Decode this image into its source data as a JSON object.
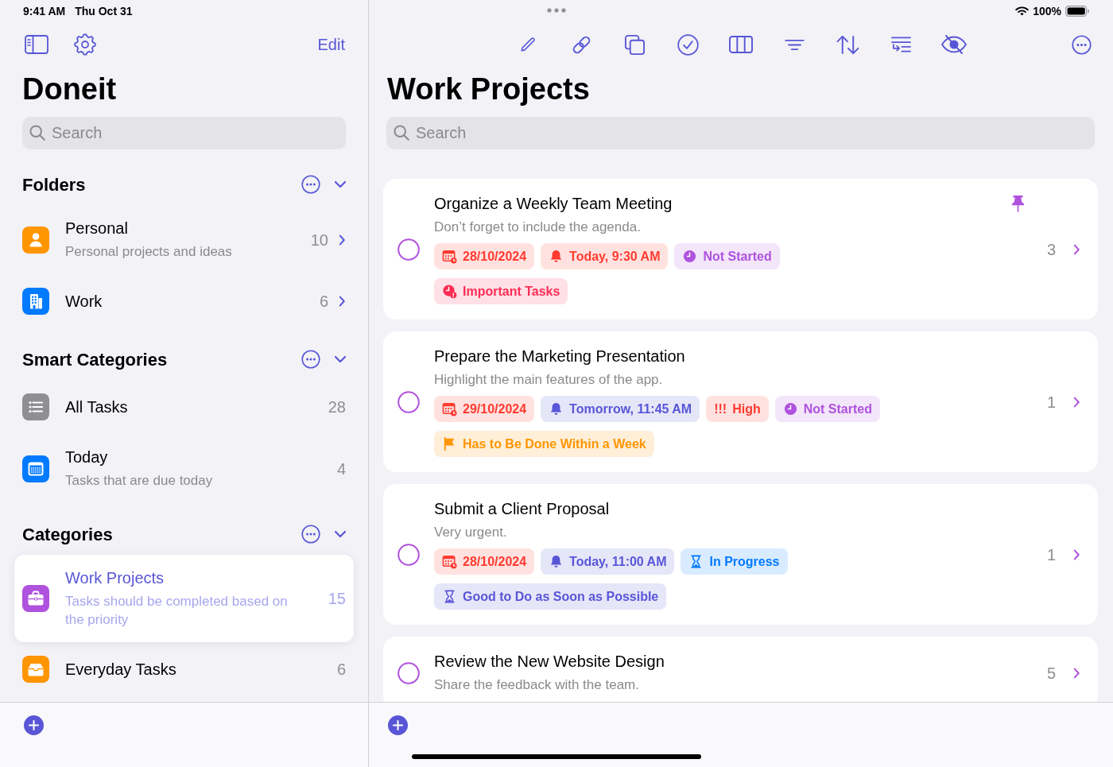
{
  "status_bar": {
    "time": "9:41 AM",
    "date": "Thu Oct 31",
    "battery": "100%"
  },
  "sidebar": {
    "edit": "Edit",
    "title": "Doneit",
    "search": {
      "placeholder": "Search"
    },
    "sections": [
      {
        "title": "Folders",
        "expanded": true,
        "items": [
          {
            "kind": "folder",
            "title": "Personal",
            "subtitle": "Personal projects and ideas",
            "count": "10",
            "color": "#ff9500",
            "selected": false
          },
          {
            "kind": "folder",
            "title": "Work",
            "count": "6",
            "color": "#007aff",
            "selected": false
          }
        ]
      },
      {
        "title": "Smart Categories",
        "expanded": true,
        "items": [
          {
            "kind": "category",
            "title": "All Tasks",
            "count": "28",
            "color": "#8e8e93",
            "selected": false
          },
          {
            "kind": "category",
            "title": "Today",
            "subtitle": "Tasks that are due today",
            "count": "4",
            "color": "#007aff",
            "selected": false
          }
        ]
      },
      {
        "title": "Categories",
        "expanded": true,
        "items": [
          {
            "kind": "category",
            "title": "Work Projects",
            "subtitle": "Tasks should be completed based on the priority",
            "count": "15",
            "color": "#af52de",
            "selected": true
          },
          {
            "kind": "category",
            "title": "Everyday Tasks",
            "count": "6",
            "color": "#ff9500",
            "selected": false
          }
        ]
      }
    ]
  },
  "main": {
    "title": "Work Projects",
    "search": {
      "placeholder": "Search"
    },
    "tasks": [
      {
        "title": "Organize a Weekly Team Meeting",
        "note": "Don’t forget to include the agenda.",
        "count": "3",
        "pinned": true,
        "completed": false,
        "tags": [
          {
            "kind": "date",
            "text": "28/10/2024",
            "color": "#ff3b30"
          },
          {
            "kind": "reminder",
            "text": "Today, 9:30 AM",
            "color": "#ff3b30"
          },
          {
            "kind": "pending",
            "text": "Not Started",
            "color": "#af52de"
          }
        ],
        "categories": [
          {
            "kind": "important",
            "text": "Important Tasks",
            "color": "#ff2d55"
          }
        ]
      },
      {
        "title": "Prepare the Marketing Presentation",
        "note": "Highlight the main features of the app.",
        "count": "1",
        "pinned": false,
        "completed": false,
        "tags": [
          {
            "kind": "date",
            "text": "29/10/2024",
            "color": "#ff3b30"
          },
          {
            "kind": "reminder",
            "text": "Tomorrow, 11:45 AM",
            "color": "#5856d6"
          },
          {
            "kind": "priority",
            "symbol": "!!!",
            "text": "High",
            "color": "#ff3b30"
          },
          {
            "kind": "pending",
            "text": "Not Started",
            "color": "#af52de"
          }
        ],
        "categories": [
          {
            "kind": "week",
            "text": "Has to Be Done Within a Week",
            "color": "#ff9500"
          }
        ]
      },
      {
        "title": "Submit a Client Proposal",
        "note": "Very urgent.",
        "count": "1",
        "pinned": false,
        "completed": false,
        "tags": [
          {
            "kind": "date",
            "text": "28/10/2024",
            "color": "#ff3b30"
          },
          {
            "kind": "reminder",
            "text": "Today, 11:00 AM",
            "color": "#5856d6"
          },
          {
            "kind": "progress",
            "text": "In Progress",
            "color": "#007aff"
          }
        ],
        "categories": [
          {
            "kind": "asap",
            "text": "Good to Do as Soon as Possible",
            "color": "#5856d6"
          }
        ]
      },
      {
        "title": "Review the New Website Design",
        "note": "Share the feedback with the team.",
        "count": "5",
        "pinned": false,
        "completed": false
      }
    ]
  }
}
